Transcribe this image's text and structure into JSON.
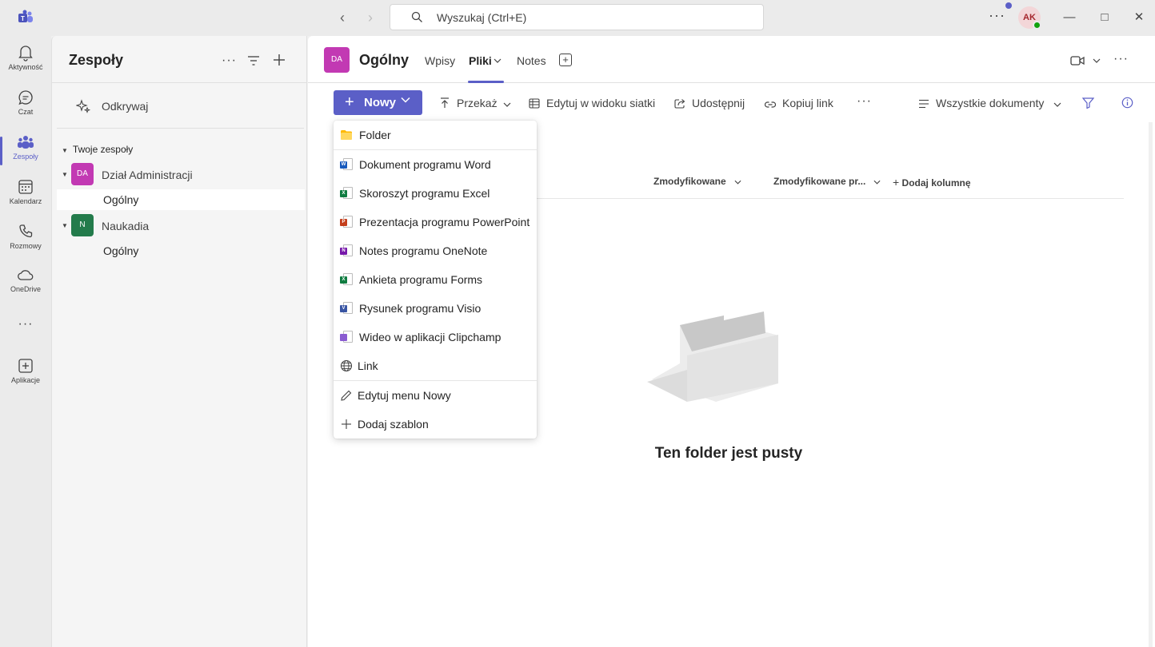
{
  "titlebar": {
    "search_placeholder": "Wyszukaj (Ctrl+E)",
    "avatar_initials": "AK"
  },
  "rail": {
    "items": [
      {
        "label": "Aktywność",
        "icon": "bell-icon"
      },
      {
        "label": "Czat",
        "icon": "chat-icon"
      },
      {
        "label": "Zespoły",
        "icon": "teams-icon"
      },
      {
        "label": "Kalendarz",
        "icon": "calendar-icon"
      },
      {
        "label": "Rozmowy",
        "icon": "phone-icon"
      },
      {
        "label": "OneDrive",
        "icon": "cloud-icon"
      },
      {
        "label": "Aplikacje",
        "icon": "add-apps-icon"
      }
    ],
    "active_color": "#5b5fc7"
  },
  "teams_panel": {
    "title": "Zespoły",
    "discover": "Odkrywaj",
    "section_label": "Twoje zespoły",
    "teams": [
      {
        "initials": "DA",
        "name": "Dział Administracji",
        "color": "#c239b3",
        "channels": [
          "Ogólny"
        ]
      },
      {
        "initials": "N",
        "name": "Naukadia",
        "color": "#237b4b",
        "channels": [
          "Ogólny"
        ]
      }
    ]
  },
  "channel": {
    "initials": "DA",
    "title": "Ogólny",
    "tabs": [
      "Wpisy",
      "Pliki",
      "Notes"
    ],
    "active_tab": "Pliki"
  },
  "commands": {
    "new": "Nowy",
    "upload": "Przekaż",
    "grid_edit": "Edytuj w widoku siatki",
    "share": "Udostępnij",
    "copy_link": "Kopiuj link",
    "more": "···",
    "view": "Wszystkie dokumenty"
  },
  "columns": {
    "modified": "Zmodyfikowane",
    "modified_by": "Zmodyfikowane pr...",
    "add_column": "Dodaj kolumnę"
  },
  "new_menu": {
    "items": [
      {
        "label": "Folder",
        "icon": "folder-icon"
      },
      {
        "label": "Dokument programu Word",
        "icon": "word-icon"
      },
      {
        "label": "Skoroszyt programu Excel",
        "icon": "excel-icon"
      },
      {
        "label": "Prezentacja programu PowerPoint",
        "icon": "powerpoint-icon"
      },
      {
        "label": "Notes programu OneNote",
        "icon": "onenote-icon"
      },
      {
        "label": "Ankieta programu Forms",
        "icon": "forms-icon"
      },
      {
        "label": "Rysunek programu Visio",
        "icon": "visio-icon"
      },
      {
        "label": "Wideo w aplikacji Clipchamp",
        "icon": "clipchamp-icon"
      },
      {
        "label": "Link",
        "icon": "globe-icon"
      }
    ],
    "footer": [
      {
        "label": "Edytuj menu Nowy",
        "icon": "pencil-icon"
      },
      {
        "label": "Dodaj szablon",
        "icon": "plus-icon"
      }
    ]
  },
  "empty_state": {
    "title": "Ten folder jest pusty"
  }
}
